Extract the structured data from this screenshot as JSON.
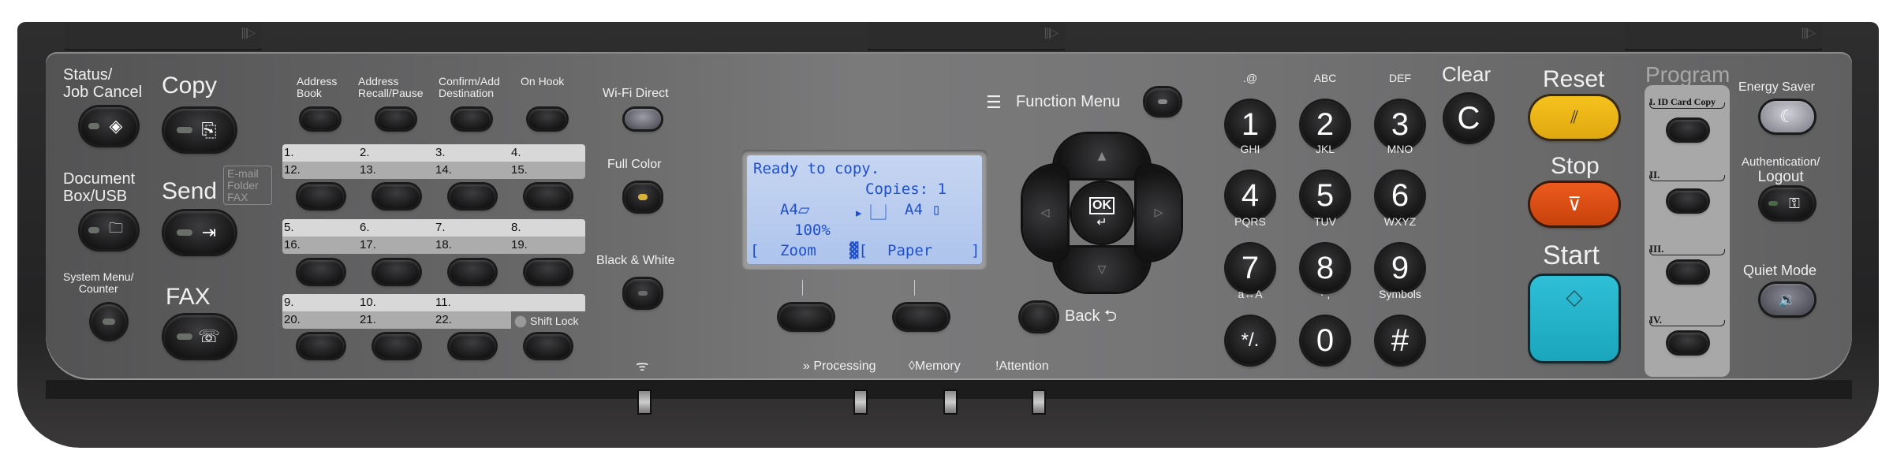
{
  "left": {
    "status_job_cancel": [
      "Status/",
      "Job Cancel"
    ],
    "copy": "Copy",
    "document_box": [
      "Document",
      "Box/USB"
    ],
    "send": "Send",
    "send_dest": [
      "E-mail",
      "Folder",
      "FAX"
    ],
    "system_menu": [
      "System Menu/",
      "Counter"
    ],
    "fax": "FAX"
  },
  "one_touch": {
    "top_labels": [
      [
        "Address",
        "Book"
      ],
      [
        "Address",
        "Recall/Pause"
      ],
      [
        "Confirm/Add",
        "Destination"
      ],
      [
        "",
        "On Hook"
      ]
    ],
    "rows": [
      {
        "top": [
          "1.",
          "2.",
          "3.",
          "4."
        ],
        "bottom": [
          "12.",
          "13.",
          "14.",
          "15."
        ]
      },
      {
        "top": [
          "5.",
          "6.",
          "7.",
          "8."
        ],
        "bottom": [
          "16.",
          "17.",
          "18.",
          "19."
        ]
      },
      {
        "top": [
          "9.",
          "10.",
          "11.",
          ""
        ],
        "bottom": [
          "20.",
          "21.",
          "22.",
          ""
        ]
      }
    ],
    "shift_lock": "Shift Lock"
  },
  "color_keys": {
    "wifi_direct": "Wi-Fi Direct",
    "full_color": "Full Color",
    "black_white": "Black & White"
  },
  "lcd": {
    "line1": "Ready to copy.",
    "copies": "Copies:  1",
    "original": "A4",
    "paper": "A4",
    "zoom_value": "100%",
    "softkey1": "Zoom",
    "softkey2": "Paper"
  },
  "nav": {
    "function_menu": "Function Menu",
    "ok": "OK",
    "back": "Back"
  },
  "indicators": {
    "processing": "Processing",
    "memory": "Memory",
    "attention": "Attention"
  },
  "keypad": {
    "keys": [
      {
        "digit": "1",
        "sub": ".@"
      },
      {
        "digit": "2",
        "sub": "ABC"
      },
      {
        "digit": "3",
        "sub": "DEF"
      },
      {
        "digit": "4",
        "sub": "GHI"
      },
      {
        "digit": "5",
        "sub": "JKL"
      },
      {
        "digit": "6",
        "sub": "MNO"
      },
      {
        "digit": "7",
        "sub": "PQRS"
      },
      {
        "digit": "8",
        "sub": "TUV"
      },
      {
        "digit": "9",
        "sub": "WXYZ"
      },
      {
        "digit": "*/.",
        "sub": "a↔A"
      },
      {
        "digit": "0",
        "sub": "· ,"
      },
      {
        "digit": "#",
        "sub": "Symbols"
      }
    ],
    "clear_label": "Clear",
    "clear_key": "C"
  },
  "main": {
    "reset": "Reset",
    "stop": "Stop",
    "start": "Start",
    "reset_color": "#f6c21c",
    "stop_color": "#ec5a1c",
    "start_color": "#2ebfd6"
  },
  "program": {
    "title": "Program",
    "slots": [
      "I. ID Card Copy",
      "II.",
      "III.",
      "IV."
    ]
  },
  "right": {
    "energy_saver": "Energy Saver",
    "auth": [
      "Authentication/",
      "Logout"
    ],
    "quiet_mode": "Quiet Mode"
  }
}
